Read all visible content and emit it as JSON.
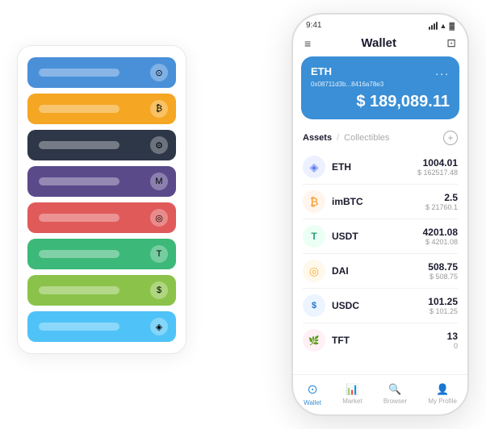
{
  "phone": {
    "time": "9:41",
    "title": "Wallet",
    "eth_card": {
      "label": "ETH",
      "address": "0x08711d3b...8416a78e3",
      "balance": "$ 189,089.11",
      "currency_symbol": "$",
      "menu_dots": "..."
    },
    "assets_tab": "Assets",
    "collectibles_tab": "Collectibles",
    "assets": [
      {
        "symbol": "ETH",
        "amount": "1004.01",
        "usd": "$ 162517.48",
        "icon": "◈"
      },
      {
        "symbol": "imBTC",
        "amount": "2.5",
        "usd": "$ 21760.1",
        "icon": "₿"
      },
      {
        "symbol": "USDT",
        "amount": "4201.08",
        "usd": "$ 4201.08",
        "icon": "T"
      },
      {
        "symbol": "DAI",
        "amount": "508.75",
        "usd": "$ 508.75",
        "icon": "◎"
      },
      {
        "symbol": "USDC",
        "amount": "101.25",
        "usd": "$ 101.25",
        "icon": "$"
      },
      {
        "symbol": "TFT",
        "amount": "13",
        "usd": "0",
        "icon": "🌿"
      }
    ],
    "nav": [
      {
        "label": "Wallet",
        "active": true,
        "icon": "⊙"
      },
      {
        "label": "Market",
        "active": false,
        "icon": "📈"
      },
      {
        "label": "Browser",
        "active": false,
        "icon": "👤"
      },
      {
        "label": "My Profile",
        "active": false,
        "icon": "👤"
      }
    ]
  },
  "card_stack": {
    "colors": [
      "#4a90d9",
      "#f5a623",
      "#2d3748",
      "#5a4a8a",
      "#e05a5a",
      "#3cb878",
      "#8bc34a",
      "#4fc3f7"
    ]
  }
}
